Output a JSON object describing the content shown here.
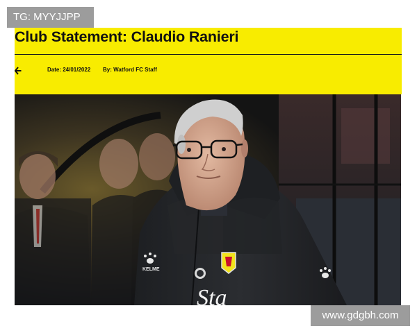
{
  "overlay": {
    "top_label": "TG: MYYJJPP",
    "bottom_watermark": "www.gdgbh.com"
  },
  "article": {
    "title": "Club Statement: Claudio Ranieri",
    "date_label": "Date: 24/01/2022",
    "author_label": "By: Watford FC Staff",
    "back_icon": "arrow-left-icon"
  },
  "colors": {
    "banner": "#f8ec00",
    "overlay_gray": "#9c9c9c"
  },
  "photo": {
    "jacket_text": "Sta",
    "brand_text": "KELME"
  }
}
